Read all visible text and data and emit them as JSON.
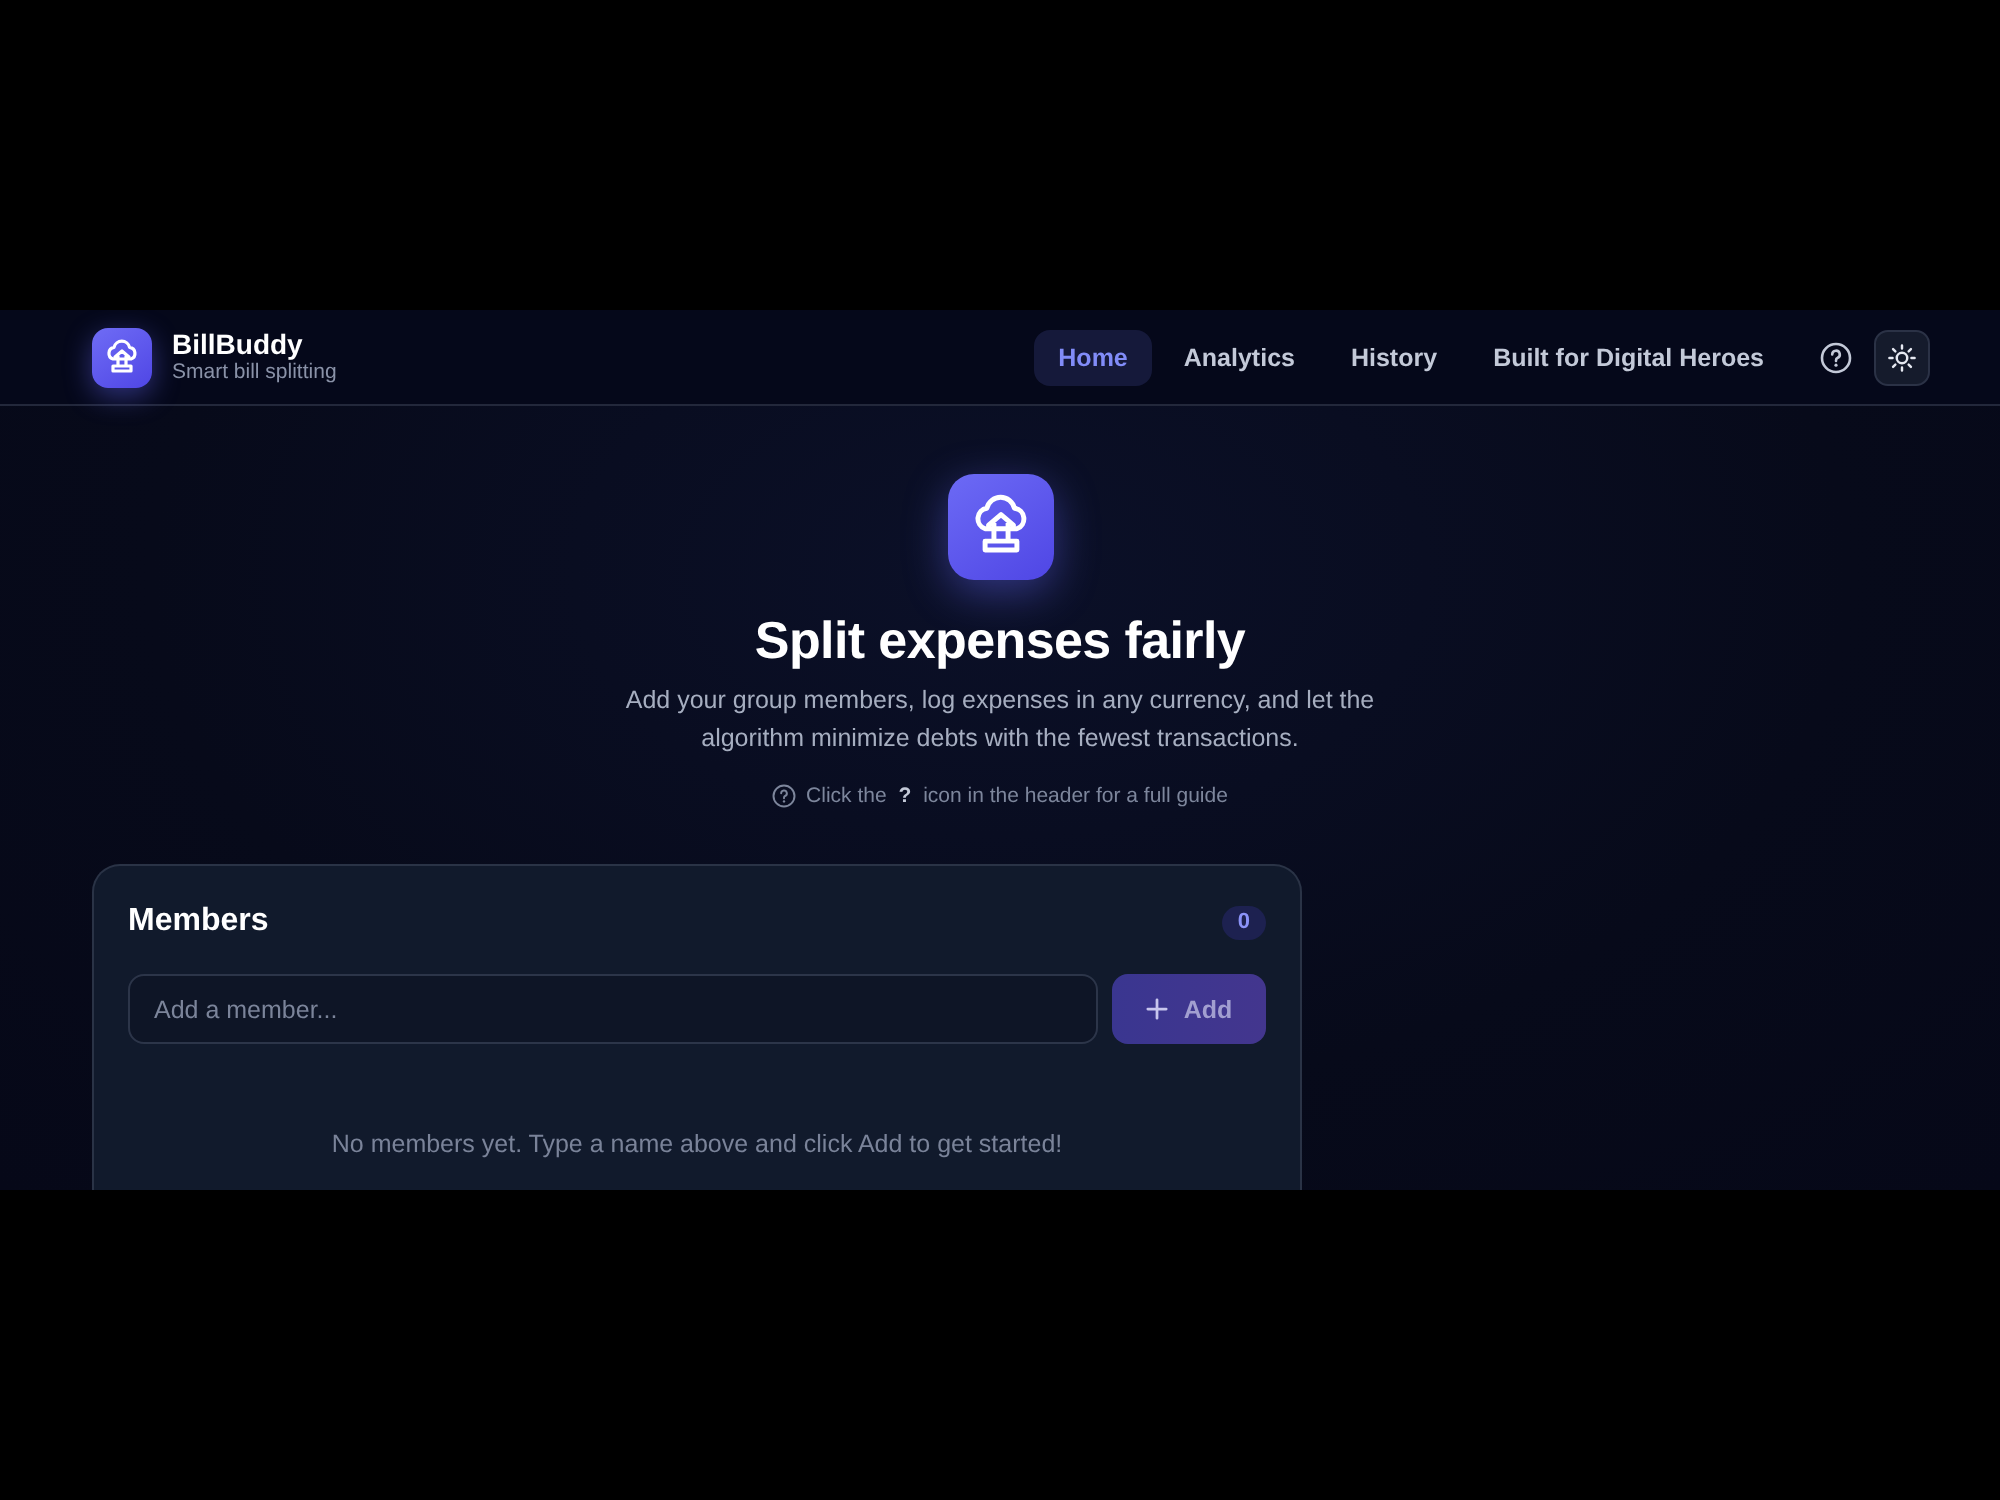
{
  "header": {
    "logo": {
      "name": "BillBuddy",
      "tagline": "Smart bill splitting"
    },
    "nav": [
      {
        "label": "Home",
        "selected": true
      },
      {
        "label": "Analytics",
        "selected": false
      },
      {
        "label": "History",
        "selected": false
      },
      {
        "label": "Built for Digital Heroes",
        "selected": false
      }
    ]
  },
  "hero": {
    "title": "Split expenses fairly",
    "description": "Add your group members, log expenses in any currency, and let the algorithm minimize debts with the fewest transactions.",
    "hint": "Click the **?** icon in the header for a full guide"
  },
  "members_card": {
    "title": "Members",
    "count": "0",
    "input": {
      "placeholder": "Add a member..."
    },
    "add_button": {
      "label": "Add",
      "disabled": true
    },
    "empty_message": "No members yet. Type a name above and click Add to get started!"
  }
}
